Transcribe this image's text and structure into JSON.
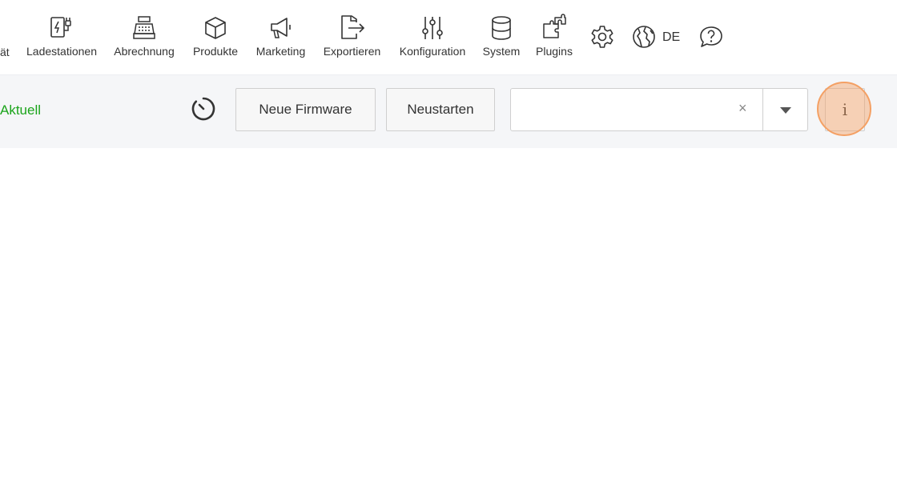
{
  "nav": {
    "cut_label": "ät",
    "items": [
      {
        "label": "Ladestationen",
        "icon": "charging-station-icon"
      },
      {
        "label": "Abrechnung",
        "icon": "cash-register-icon"
      },
      {
        "label": "Produkte",
        "icon": "box-icon"
      },
      {
        "label": "Marketing",
        "icon": "megaphone-icon"
      },
      {
        "label": "Exportieren",
        "icon": "export-icon"
      },
      {
        "label": "Konfiguration",
        "icon": "sliders-icon"
      },
      {
        "label": "System",
        "icon": "database-icon"
      },
      {
        "label": "Plugins",
        "icon": "puzzle-icon"
      }
    ],
    "settings_icon": "gear-icon",
    "language_icon": "globe-icon",
    "language": "DE",
    "help_icon": "help-bubble-icon"
  },
  "toolbar": {
    "status": "Aktuell",
    "status_color": "#1ba41b",
    "timer_icon": "timer-icon",
    "new_firmware_label": "Neue Firmware",
    "restart_label": "Neustarten",
    "combo_value": "",
    "clear_symbol": "×",
    "info_label": "i",
    "highlight_color": "#f4a064"
  }
}
